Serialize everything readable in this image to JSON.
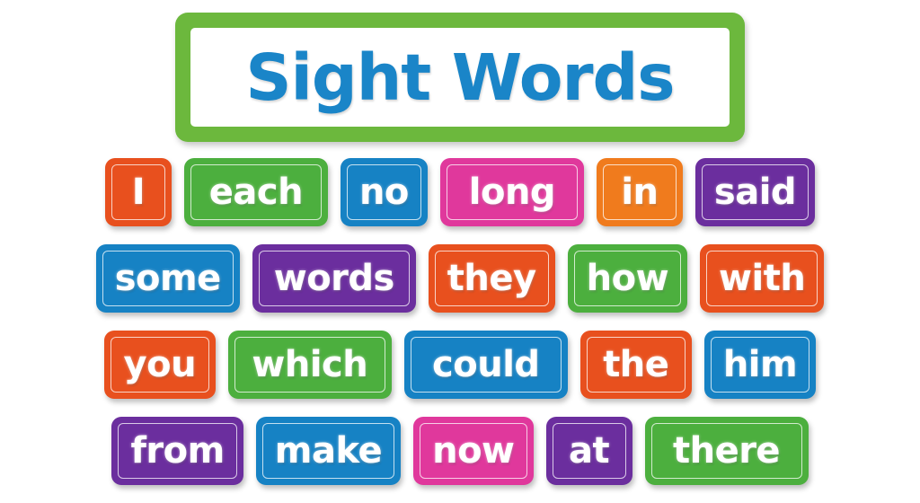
{
  "poster": {
    "title": "Sight Words",
    "title_text_color": "#1A85C8",
    "title_border_color": "#6CB83D",
    "title_background_color": "#FFFFFF",
    "page_background_color": "#FFFFFF"
  },
  "palette": {
    "orange_red": "#E8501E",
    "orange": "#F07B1D",
    "green": "#4CAF3E",
    "green_light": "#7CC242",
    "blue": "#1682C4",
    "blue_light": "#1A9FDC",
    "pink": "#E0389C",
    "pink_dark": "#E02A8D",
    "purple": "#6B2E9E",
    "purple_dark": "#5E2482"
  },
  "rows": [
    {
      "row_name": "row-1",
      "cards": [
        {
          "word": "I",
          "color": "#E8501E",
          "outline": "#F3864F",
          "size": "w-xs"
        },
        {
          "word": "each",
          "color": "#4CAF3E",
          "outline": "#8FD46F",
          "size": "w-lg"
        },
        {
          "word": "no",
          "color": "#1682C4",
          "outline": "#5FC8F0",
          "size": "w-sm"
        },
        {
          "word": "long",
          "color": "#E0389C",
          "outline": "#F58CC8",
          "size": "w-lg"
        },
        {
          "word": "in",
          "color": "#F07B1D",
          "outline": "#F8BE7A",
          "size": "w-sm"
        },
        {
          "word": "said",
          "color": "#6B2E9E",
          "outline": "#C79BE2",
          "size": "w-md"
        }
      ]
    },
    {
      "row_name": "row-2",
      "cards": [
        {
          "word": "some",
          "color": "#1682C4",
          "outline": "#5FC8F0",
          "size": "w-lg"
        },
        {
          "word": "words",
          "color": "#6B2E9E",
          "outline": "#C79BE2",
          "size": "w-xl"
        },
        {
          "word": "they",
          "color": "#E8501E",
          "outline": "#F3864F",
          "size": "w-md"
        },
        {
          "word": "how",
          "color": "#4CAF3E",
          "outline": "#8FD46F",
          "size": "w-md"
        },
        {
          "word": "with",
          "color": "#E8501E",
          "outline": "#F3864F",
          "size": "w-md"
        }
      ]
    },
    {
      "row_name": "row-3",
      "cards": [
        {
          "word": "you",
          "color": "#E8501E",
          "outline": "#F3864F",
          "size": "w-md"
        },
        {
          "word": "which",
          "color": "#4CAF3E",
          "outline": "#8FD46F",
          "size": "w-xl"
        },
        {
          "word": "could",
          "color": "#1682C4",
          "outline": "#5FC8F0",
          "size": "w-xl"
        },
        {
          "word": "the",
          "color": "#E8501E",
          "outline": "#F3864F",
          "size": "w-md"
        },
        {
          "word": "him",
          "color": "#1682C4",
          "outline": "#5FC8F0",
          "size": "w-md"
        }
      ]
    },
    {
      "row_name": "row-4",
      "cards": [
        {
          "word": "from",
          "color": "#6B2E9E",
          "outline": "#C79BE2",
          "size": "w-md"
        },
        {
          "word": "make",
          "color": "#1682C4",
          "outline": "#5FC8F0",
          "size": "w-md"
        },
        {
          "word": "now",
          "color": "#E0389C",
          "outline": "#F58CC8",
          "size": "w-md"
        },
        {
          "word": "at",
          "color": "#6B2E9E",
          "outline": "#C79BE2",
          "size": "w-sm"
        },
        {
          "word": "there",
          "color": "#4CAF3E",
          "outline": "#8FD46F",
          "size": "w-xl"
        }
      ]
    }
  ]
}
